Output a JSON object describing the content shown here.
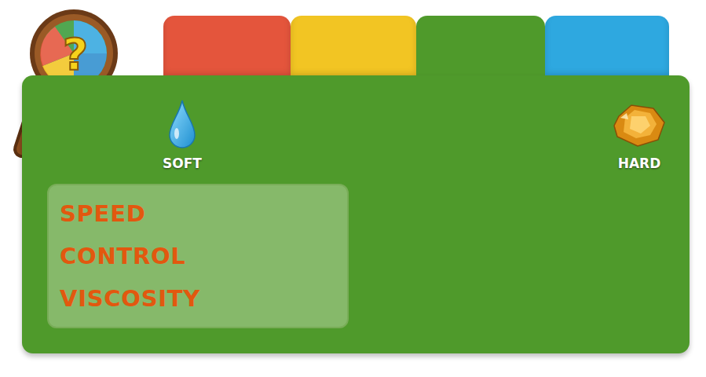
{
  "magnifier": {
    "glyph": "?"
  },
  "tabs": [
    {
      "selected": false,
      "color": "#e4553c"
    },
    {
      "selected": false,
      "color": "#f2c523"
    },
    {
      "selected": true,
      "color": "#4f9a2b"
    },
    {
      "selected": false,
      "color": "#2ea8e0"
    }
  ],
  "scale": {
    "min_label": "SOFT",
    "max_label": "HARD"
  },
  "properties": [
    "SPEED",
    "CONTROL",
    "VISCOSITY"
  ]
}
